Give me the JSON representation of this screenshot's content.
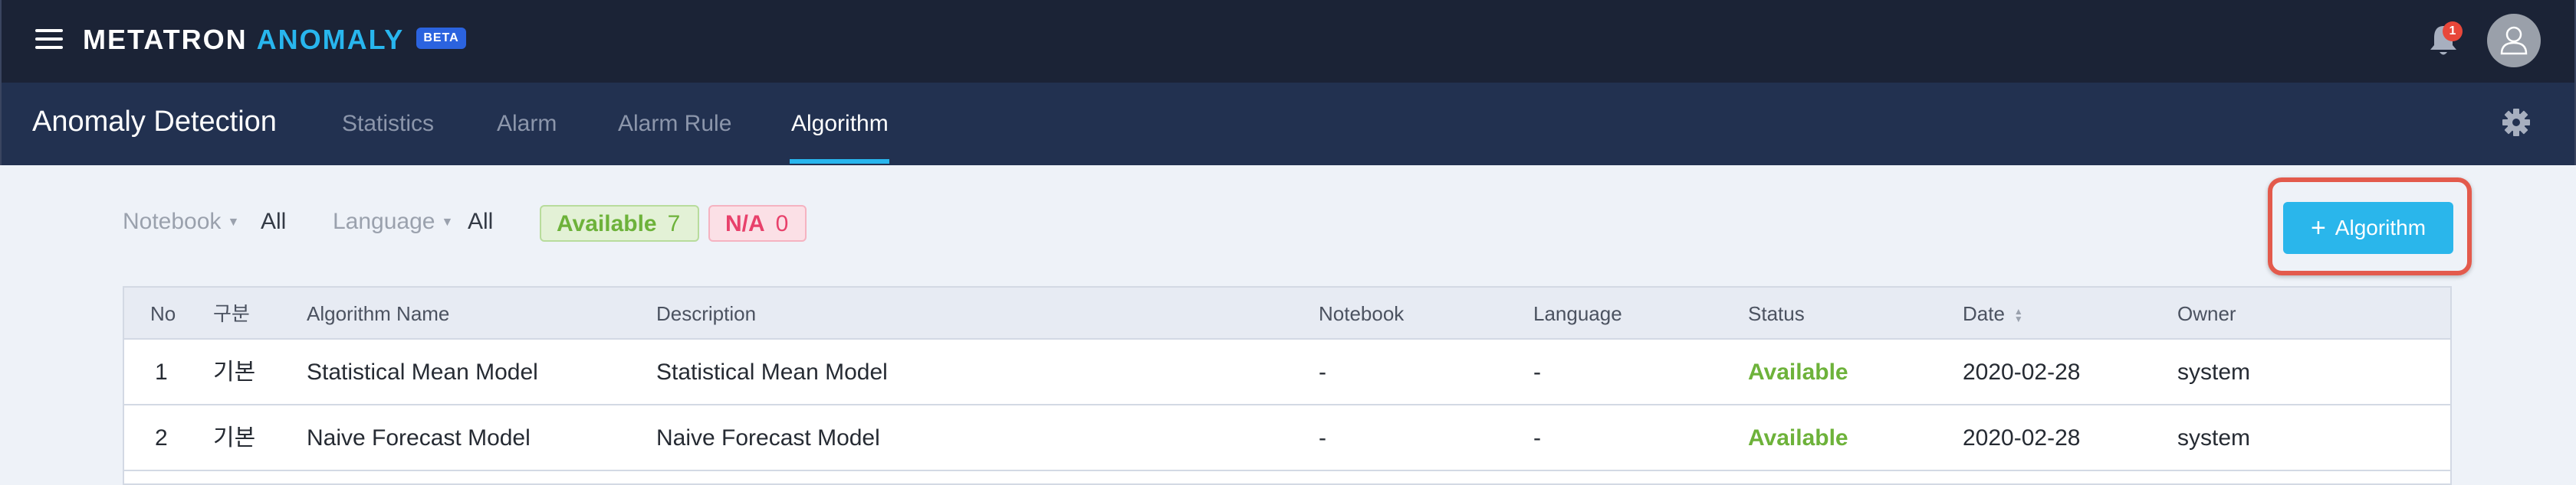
{
  "header": {
    "brand_primary": "METATRON",
    "brand_secondary": "ANOMALY",
    "beta_label": "BETA",
    "notification_count": "1"
  },
  "subnav": {
    "title": "Anomaly Detection",
    "tabs": [
      {
        "label": "Statistics"
      },
      {
        "label": "Alarm"
      },
      {
        "label": "Alarm Rule"
      },
      {
        "label": "Algorithm",
        "active": true
      }
    ]
  },
  "filters": {
    "notebook_label": "Notebook",
    "notebook_value": "All",
    "language_label": "Language",
    "language_value": "All",
    "available_label": "Available",
    "available_count": "7",
    "na_label": "N/A",
    "na_count": "0"
  },
  "add_button_label": "Algorithm",
  "table": {
    "columns": [
      "No",
      "구분",
      "Algorithm Name",
      "Description",
      "Notebook",
      "Language",
      "Status",
      "Date",
      "Owner"
    ],
    "rows": [
      [
        "1",
        "기본",
        "Statistical Mean Model",
        "Statistical Mean Model",
        "-",
        "-",
        "Available",
        "2020-02-28",
        "system"
      ],
      [
        "2",
        "기본",
        "Naive Forecast Model",
        "Naive Forecast Model",
        "-",
        "-",
        "Available",
        "2020-02-28",
        "system"
      ]
    ]
  },
  "colors": {
    "topbar": "#1b2336",
    "subnav": "#223150",
    "accent": "#28b6ee",
    "available": "#6db23a",
    "na": "#e8416b",
    "highlight": "#e35a4c"
  }
}
